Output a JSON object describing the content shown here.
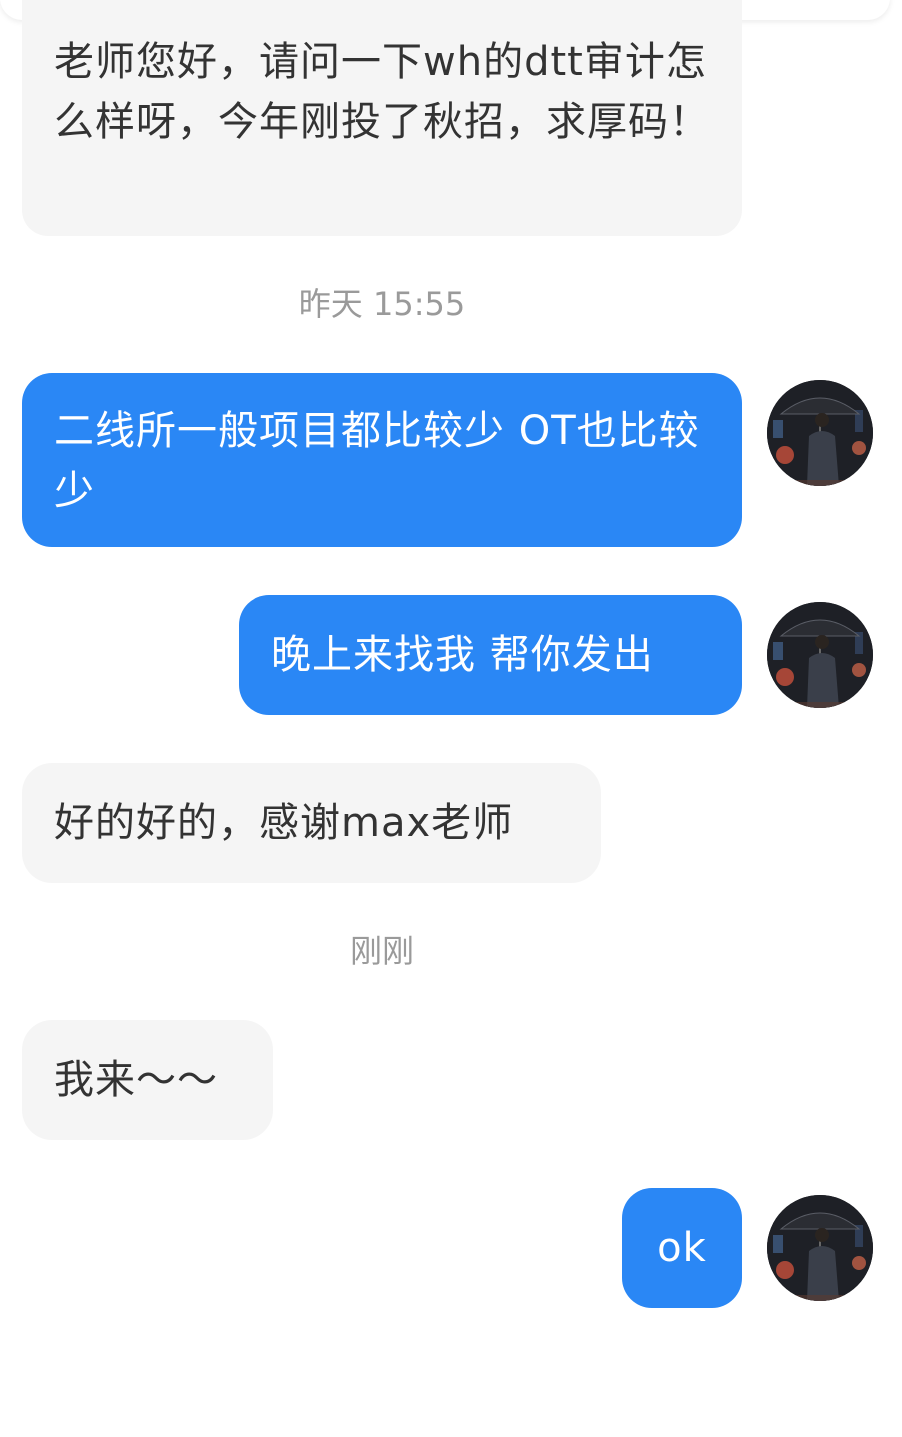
{
  "colors": {
    "outgoing_bubble": "#2a87f5",
    "incoming_bubble": "#f5f5f5",
    "incoming_text": "#333333",
    "timestamp_text": "#9a9a9a"
  },
  "avatar": {
    "icon": "user-avatar-man-with-umbrella-icon"
  },
  "messages": [
    {
      "direction": "incoming",
      "text": "老师您好，请问一下wh的dtt审计怎么样呀，今年刚投了秋招，求厚码！"
    },
    {
      "type": "timestamp",
      "text": "昨天 15:55"
    },
    {
      "direction": "outgoing",
      "text": "二线所一般项目都比较少 OT也比较少"
    },
    {
      "direction": "outgoing",
      "text": "晚上来找我 帮你发出"
    },
    {
      "direction": "incoming",
      "text": "好的好的，感谢max老师"
    },
    {
      "type": "timestamp",
      "text": "刚刚"
    },
    {
      "direction": "incoming",
      "text": "我来～～"
    },
    {
      "direction": "outgoing",
      "text": "ok"
    }
  ]
}
